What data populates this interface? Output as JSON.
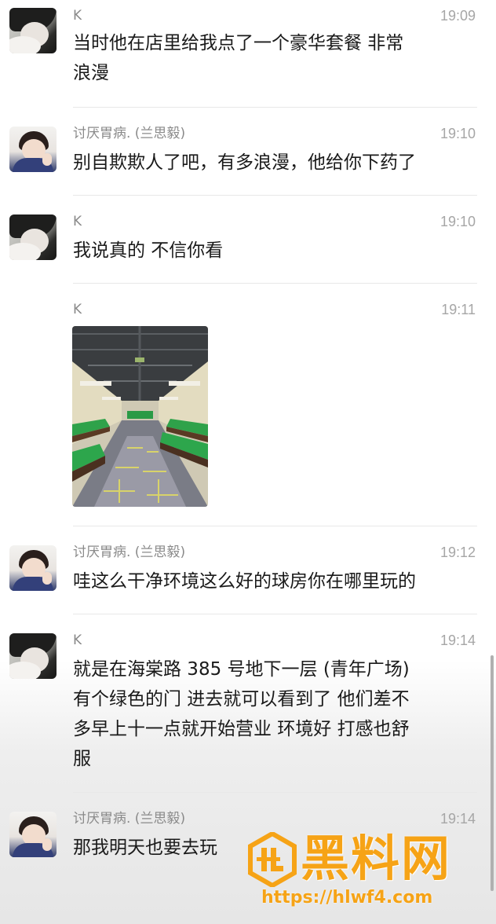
{
  "messages": [
    {
      "sender": "K",
      "time": "19:09",
      "text": "当时他在店里给我点了一个豪华套餐 非常\n浪漫"
    },
    {
      "sender": "讨厌胃病. (兰思毅)",
      "time": "19:10",
      "text": "别自欺欺人了吧，有多浪漫，他给你下药了"
    },
    {
      "sender": "K",
      "time": "19:10",
      "text": "我说真的 不信你看"
    },
    {
      "sender": "K",
      "time": "19:11",
      "image": "billiard-hall-photo"
    },
    {
      "sender": "讨厌胃病. (兰思毅)",
      "time": "19:12",
      "text": "哇这么干净环境这么好的球房你在哪里玩的"
    },
    {
      "sender": "K",
      "time": "19:14",
      "text": "就是在海棠路 385 号地下一层 (青年广场)\n有个绿色的门 进去就可以看到了 他们差不\n多早上十一点就开始营业 环境好 打感也舒\n服"
    },
    {
      "sender": "讨厌胃病. (兰思毅)",
      "time": "19:14",
      "text": "那我明天也要去玩"
    }
  ],
  "watermark": {
    "title": "黑料网",
    "url": "https://hlwf4.com",
    "color": "#f6a316"
  },
  "colors": {
    "name": "#8a8a8a",
    "time": "#a6a6a6",
    "text": "#1a1a1a",
    "divider": "#e8e8e8"
  }
}
